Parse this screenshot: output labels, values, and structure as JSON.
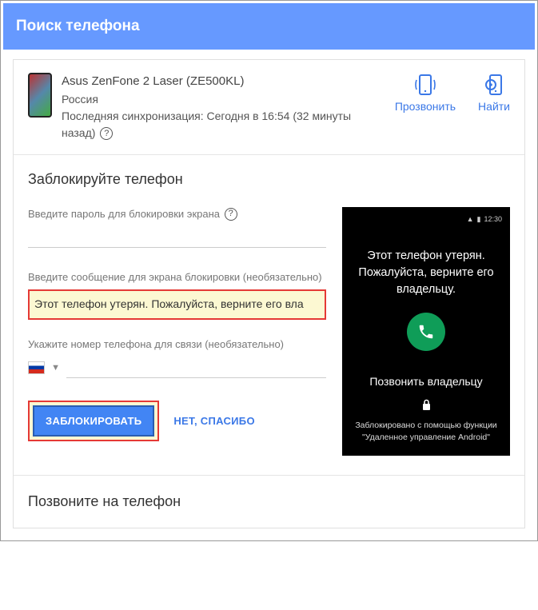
{
  "header": {
    "title": "Поиск телефона"
  },
  "device": {
    "name": "Asus ZenFone 2 Laser (ZE500KL)",
    "location": "Россия",
    "sync": "Последняя синхронизация: Сегодня в 16:54 (32 минуты назад)"
  },
  "actions": {
    "ring": "Прозвонить",
    "find": "Найти"
  },
  "lock": {
    "title": "Заблокируйте телефон",
    "password_label": "Введите пароль для блокировки экрана",
    "message_label": "Введите сообщение для экрана блокировки (необязательно)",
    "message_value": "Этот телефон утерян. Пожалуйста, верните его вла",
    "phone_label": "Укажите номер телефона для связи (необязательно)",
    "button_lock": "ЗАБЛОКИРОВАТЬ",
    "button_skip": "НЕТ, СПАСИБО"
  },
  "preview": {
    "time": "12:30",
    "message": "Этот телефон утерян. Пожалуйста, верните его владельцу.",
    "call_owner": "Позвонить владельцу",
    "footer1": "Заблокировано с помощью функции",
    "footer2": "\"Удаленное управление Android\""
  },
  "call_section": {
    "title": "Позвоните на телефон"
  }
}
